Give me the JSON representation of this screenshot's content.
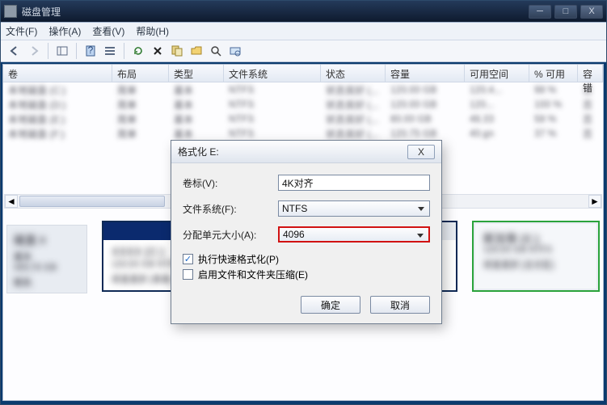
{
  "window": {
    "title": "磁盘管理",
    "controls": {
      "min": "─",
      "max": "□",
      "close": "X"
    }
  },
  "menu": {
    "file": "文件(F)",
    "action": "操作(A)",
    "view": "查看(V)",
    "help": "帮助(H)"
  },
  "columns": {
    "volume": "卷",
    "layout": "布局",
    "type": "类型",
    "filesystem": "文件系统",
    "status": "状态",
    "capacity": "容量",
    "free": "可用空间",
    "percent": "% 可用",
    "faults": "容错"
  },
  "rows": [
    {
      "volume": "本地磁盘 (C:)",
      "layout": "简单",
      "type": "基本",
      "fs": "NTFS",
      "status": "状态良好 (...",
      "cap": "120.00 GB",
      "free": "120.4...",
      "pct": "98 %",
      "fault": "否"
    },
    {
      "volume": "本地磁盘 (D:)",
      "layout": "简单",
      "type": "基本",
      "fs": "NTFS",
      "status": "状态良好 (...",
      "cap": "120.00 GB",
      "free": "120...",
      "pct": "100 %",
      "fault": "否"
    },
    {
      "volume": "本地磁盘 (E:)",
      "layout": "简单",
      "type": "基本",
      "fs": "NTFS",
      "status": "状态良好 (...",
      "cap": "80.00 GB",
      "free": "46.33",
      "pct": "58 %",
      "fault": "否"
    },
    {
      "volume": "本地磁盘 (F:)",
      "layout": "简单",
      "type": "基本",
      "fs": "NTFS",
      "status": "状态良好 (...",
      "cap": "120.75 GB",
      "free": "40.gn",
      "pct": "37 %",
      "fault": "否"
    }
  ],
  "dialog": {
    "title": "格式化 E:",
    "close_label": "X",
    "label_volume": "卷标(V):",
    "label_fs": "文件系统(F):",
    "label_aus": "分配单元大小(A):",
    "volume_value": "4K对齐",
    "fs_value": "NTFS",
    "aus_value": "4096",
    "check_quick": "执行快速格式化(P)",
    "check_compress": "启用文件和文件夹压缩(E)",
    "ok": "确定",
    "cancel": "取消"
  }
}
